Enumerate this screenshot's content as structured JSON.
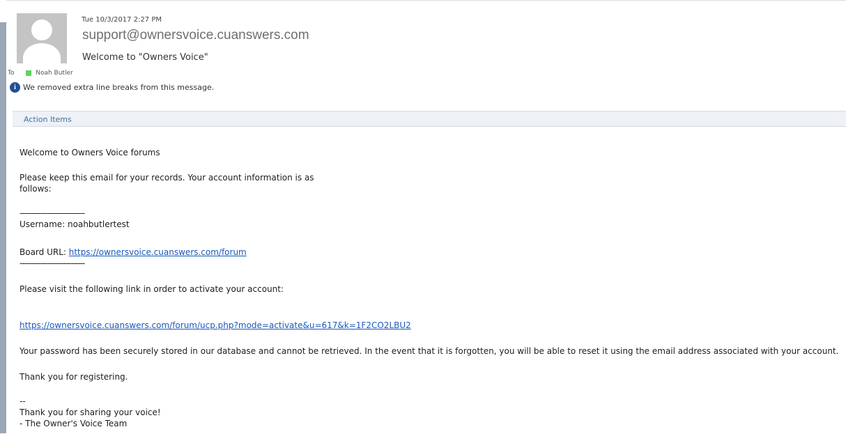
{
  "email": {
    "date": "Tue 10/3/2017 2:27 PM",
    "from": "support@ownersvoice.cuanswers.com",
    "subject": "Welcome to \"Owners Voice\"",
    "to_label": "To",
    "to_name": "Noah Butler",
    "info_text": "We removed extra line breaks from this message.",
    "action_items_label": "Action Items",
    "body": {
      "welcome": "Welcome to Owners Voice forums",
      "keep_line1": "Please keep this email for your records. Your account information is as",
      "keep_line2": "follows:",
      "divider_top": "----------------------------",
      "username": "Username: noahbutlertest",
      "board_url_label": "Board URL: ",
      "board_url": "https://ownersvoice.cuanswers.com/forum",
      "divider_bottom": "----------------------------",
      "visit_text": "Please visit the following link in order to activate your account:",
      "activation_link": "https://ownersvoice.cuanswers.com/forum/ucp.php?mode=activate&u=617&k=1F2CO2LBU2",
      "password_text": "Your password has been securely stored in our database and cannot be retrieved. In the event that it is forgotten, you will be able to reset it using the email address associated with your account.",
      "thanks": "Thank you for registering.",
      "sig_dashes": "--",
      "sig_line1": "Thank you for sharing your voice!",
      "sig_line2": "- The Owner's Voice Team"
    }
  },
  "colors": {
    "link": "#1a58bb",
    "action_label": "#3f6faa",
    "presence": "#5fd45f",
    "info_icon": "#1f4f97"
  },
  "icons": {
    "avatar": "person-silhouette-icon",
    "info": "info-icon",
    "presence": "presence-icon"
  }
}
